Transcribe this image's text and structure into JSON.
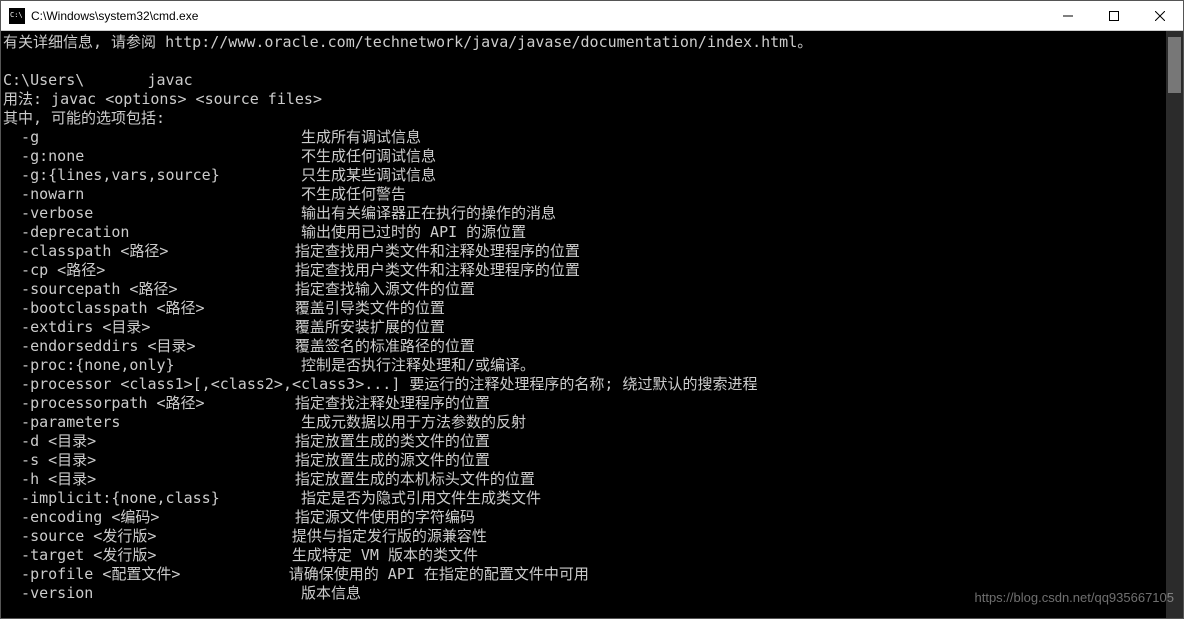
{
  "window": {
    "title": "C:\\Windows\\system32\\cmd.exe"
  },
  "terminal": {
    "info_line": "有关详细信息, 请参阅 http://www.oracle.com/technetwork/java/javase/documentation/index.html。",
    "blank": "",
    "prompt_line": "C:\\Users\\       javac",
    "usage_line": "用法: javac <options> <source files>",
    "where_line": "其中, 可能的选项包括:",
    "options": [
      {
        "flag": "  -g",
        "desc": "生成所有调试信息"
      },
      {
        "flag": "  -g:none",
        "desc": "不生成任何调试信息"
      },
      {
        "flag": "  -g:{lines,vars,source}",
        "desc": "只生成某些调试信息"
      },
      {
        "flag": "  -nowarn",
        "desc": "不生成任何警告"
      },
      {
        "flag": "  -verbose",
        "desc": "输出有关编译器正在执行的操作的消息"
      },
      {
        "flag": "  -deprecation",
        "desc": "输出使用已过时的 API 的源位置"
      },
      {
        "flag": "  -classpath <路径>",
        "desc": "指定查找用户类文件和注释处理程序的位置"
      },
      {
        "flag": "  -cp <路径>",
        "desc": "指定查找用户类文件和注释处理程序的位置"
      },
      {
        "flag": "  -sourcepath <路径>",
        "desc": "指定查找输入源文件的位置"
      },
      {
        "flag": "  -bootclasspath <路径>",
        "desc": "覆盖引导类文件的位置"
      },
      {
        "flag": "  -extdirs <目录>",
        "desc": "覆盖所安装扩展的位置"
      },
      {
        "flag": "  -endorseddirs <目录>",
        "desc": "覆盖签名的标准路径的位置"
      },
      {
        "flag": "  -proc:{none,only}",
        "desc": "控制是否执行注释处理和/或编译。"
      },
      {
        "flag": "  -processor <class1>[,<class2>,<class3>...] 要运行的注释处理程序的名称; 绕过默认的搜索进程",
        "desc": ""
      },
      {
        "flag": "  -processorpath <路径>",
        "desc": "指定查找注释处理程序的位置"
      },
      {
        "flag": "  -parameters",
        "desc": "生成元数据以用于方法参数的反射"
      },
      {
        "flag": "  -d <目录>",
        "desc": "指定放置生成的类文件的位置"
      },
      {
        "flag": "  -s <目录>",
        "desc": "指定放置生成的源文件的位置"
      },
      {
        "flag": "  -h <目录>",
        "desc": "指定放置生成的本机标头文件的位置"
      },
      {
        "flag": "  -implicit:{none,class}",
        "desc": "指定是否为隐式引用文件生成类文件"
      },
      {
        "flag": "  -encoding <编码>",
        "desc": "指定源文件使用的字符编码"
      },
      {
        "flag": "  -source <发行版>",
        "desc": "提供与指定发行版的源兼容性"
      },
      {
        "flag": "  -target <发行版>",
        "desc": "生成特定 VM 版本的类文件"
      },
      {
        "flag": "  -profile <配置文件>",
        "desc": "请确保使用的 API 在指定的配置文件中可用"
      },
      {
        "flag": "  -version",
        "desc": "版本信息"
      }
    ],
    "flag_col_width": 33
  },
  "watermark": "https://blog.csdn.net/qq935667105"
}
